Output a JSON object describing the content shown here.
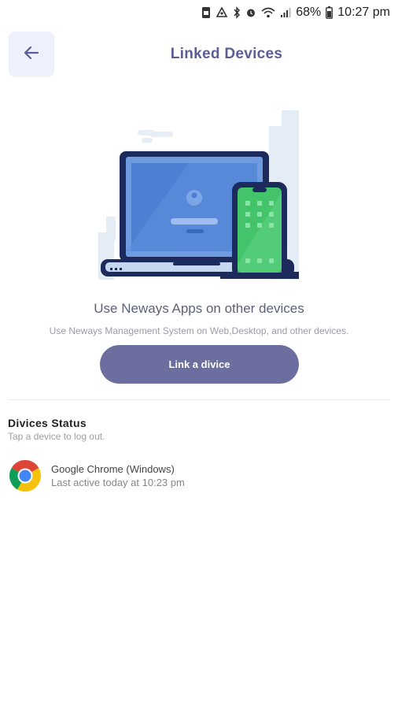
{
  "status_bar": {
    "battery": "68%",
    "time": "10:27 pm"
  },
  "header": {
    "title": "Linked Devices"
  },
  "promo": {
    "title": "Use Neways Apps on other devices",
    "subtitle": "Use Neways Management System on Web,Desktop, and other devices.",
    "button_label": "Link a divice"
  },
  "devices_section": {
    "title": "Divices Status",
    "subtitle": "Tap a device to log out.",
    "devices": [
      {
        "name": "Google Chrome (Windows)",
        "last_active": "Last active today at 10:23 pm",
        "icon": "chrome-icon"
      }
    ]
  },
  "colors": {
    "accent": "#6c6ea0",
    "title": "#5a5e94",
    "back_button_bg": "#eef0fb"
  }
}
